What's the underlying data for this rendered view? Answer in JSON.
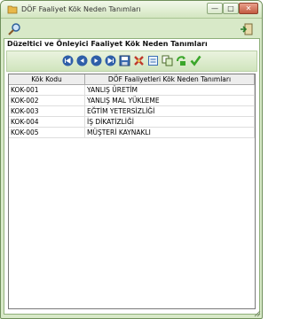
{
  "window": {
    "title": "DÖF Faaliyet Kök Neden Tanımları",
    "min_glyph": "—",
    "max_glyph": "□",
    "close_glyph": "✕"
  },
  "panel": {
    "header": "Düzeltici ve Önleyici Faaliyet Kök Neden Tanımları"
  },
  "table": {
    "columns": [
      "Kök Kodu",
      "DÖF Faaliyetleri Kök Neden Tanımları"
    ],
    "rows": [
      [
        "KOK-001",
        "YANLIŞ ÜRETİM"
      ],
      [
        "KOK-002",
        "YANLIŞ MAL YÜKLEME"
      ],
      [
        "KOK-003",
        "EĞTİM YETERSİZLİĞİ"
      ],
      [
        "KOK-004",
        "İŞ DİKATİZLİĞİ"
      ],
      [
        "KOK-005",
        "MÜŞTERİ KAYNAKLI"
      ]
    ]
  },
  "toolbar_icons": [
    "search-icon",
    "exit-icon",
    "first-record-icon",
    "previous-record-icon",
    "next-record-icon",
    "last-record-icon",
    "save-icon",
    "delete-icon",
    "new-record-icon",
    "copy-icon",
    "refresh-icon",
    "confirm-check-icon"
  ],
  "colors": {
    "window_bg": "#d8e9c8",
    "nav_button": "#2f5fa8",
    "confirm_green": "#3aa62a"
  }
}
